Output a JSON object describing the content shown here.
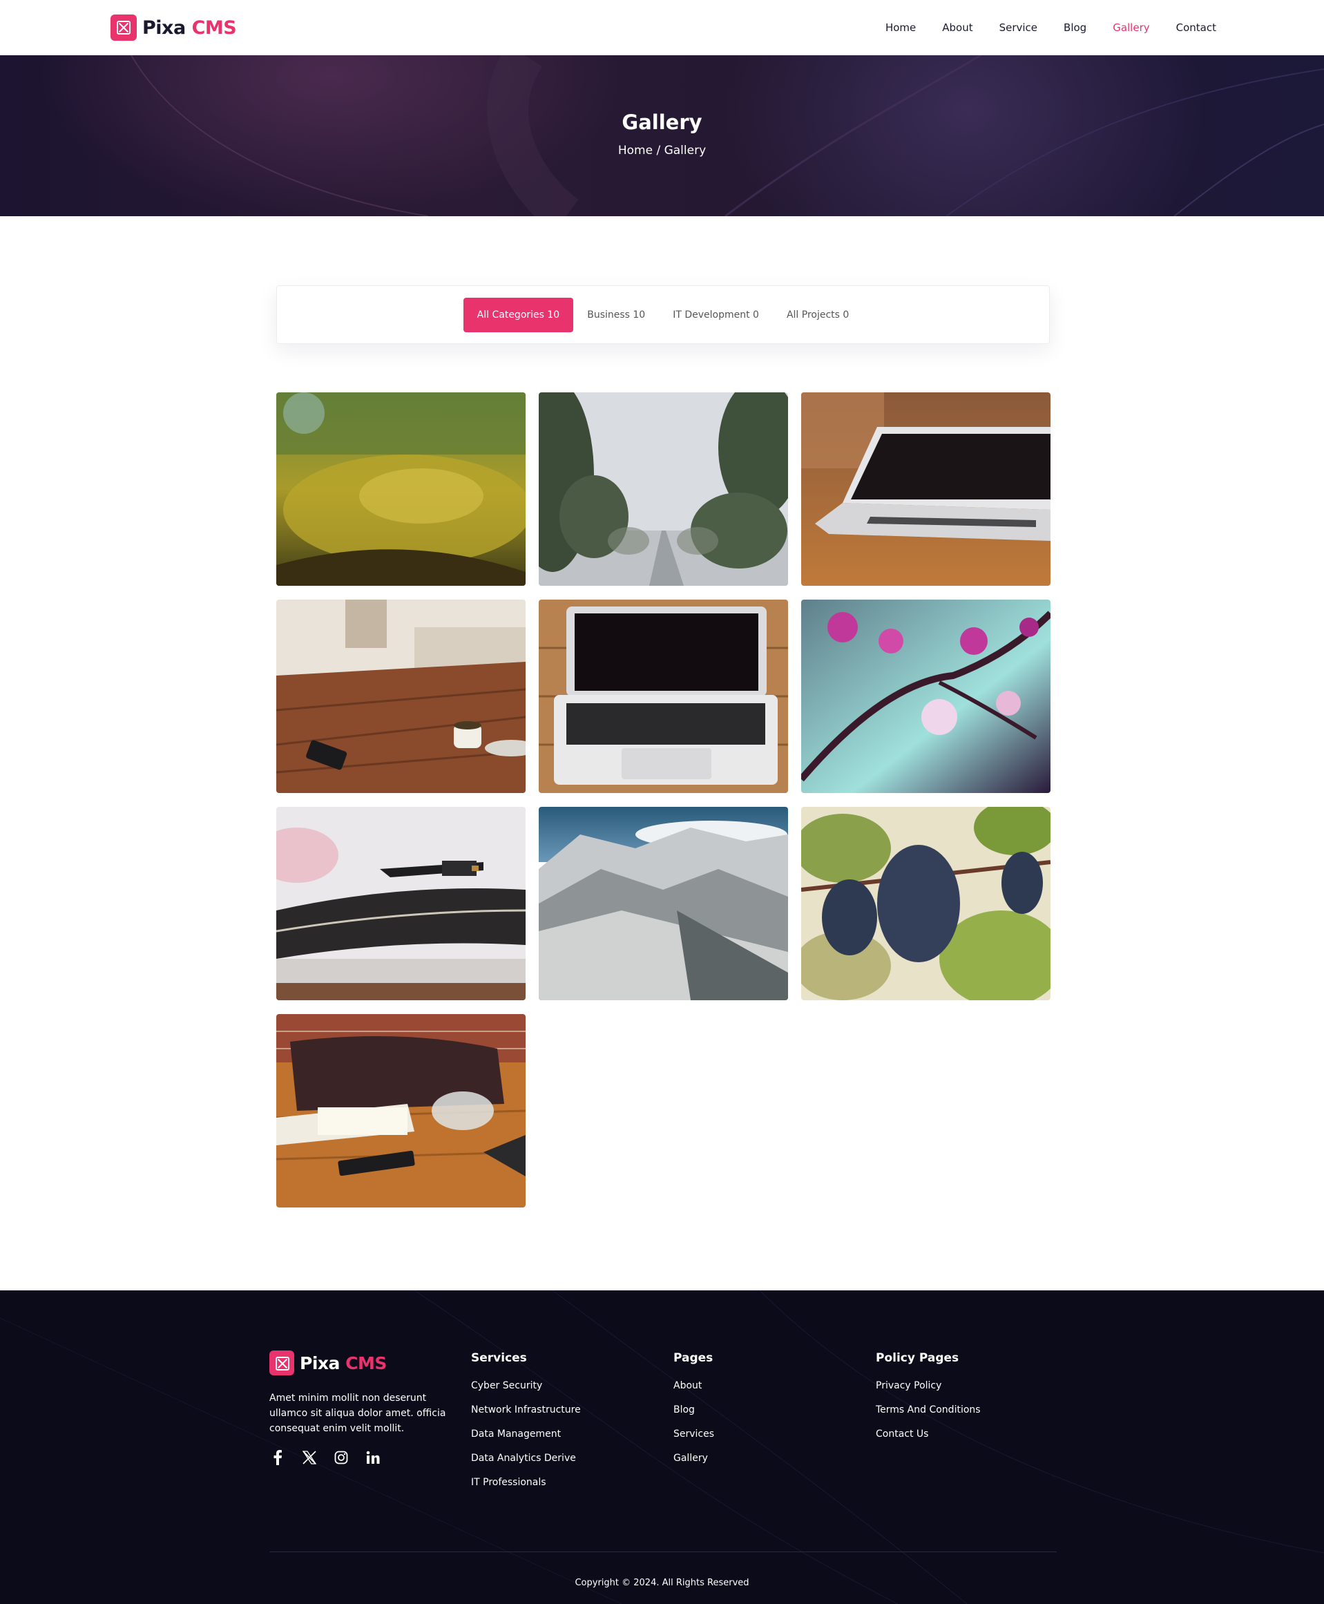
{
  "brand": {
    "name_part1": "Pixa",
    "name_part2": "CMS",
    "accent_color": "#e8336d"
  },
  "nav": {
    "items": [
      {
        "label": "Home"
      },
      {
        "label": "About"
      },
      {
        "label": "Service"
      },
      {
        "label": "Blog"
      },
      {
        "label": "Gallery",
        "active": true
      },
      {
        "label": "Contact"
      }
    ]
  },
  "hero": {
    "title": "Gallery",
    "breadcrumb": "Home / Gallery"
  },
  "filters": {
    "tabs": [
      {
        "label": "All Categories 10",
        "active": true
      },
      {
        "label": "Business 10"
      },
      {
        "label": "IT Development 0"
      },
      {
        "label": "All Projects 0"
      }
    ]
  },
  "gallery": {
    "images": [
      {
        "subject": "moss-covered tree trunk"
      },
      {
        "subject": "foggy tree-lined road"
      },
      {
        "subject": "laptop on wooden desk"
      },
      {
        "subject": "cafe table with coffee cup and phone"
      },
      {
        "subject": "open laptop on wooden planks"
      },
      {
        "subject": "pink blossoms on branch"
      },
      {
        "subject": "record player tonearm"
      },
      {
        "subject": "snowy mountain valley"
      },
      {
        "subject": "grape cluster on vine"
      },
      {
        "subject": "desk with notebook, glass and phone"
      }
    ]
  },
  "footer": {
    "description": "Amet minim mollit non deserunt ullamco sit aliqua dolor amet. officia consequat enim velit mollit.",
    "socials": [
      "facebook-icon",
      "x-icon",
      "instagram-icon",
      "linkedin-icon"
    ],
    "columns": [
      {
        "title": "Services",
        "links": [
          "Cyber Security",
          "Network Infrastructure",
          "Data Management",
          "Data Analytics Derive",
          "IT Professionals"
        ]
      },
      {
        "title": "Pages",
        "links": [
          "About",
          "Blog",
          "Services",
          "Gallery"
        ]
      },
      {
        "title": "Policy Pages",
        "links": [
          "Privacy Policy",
          "Terms And Conditions",
          "Contact Us"
        ]
      }
    ],
    "copyright": "Copyright © 2024. All Rights Reserved"
  }
}
